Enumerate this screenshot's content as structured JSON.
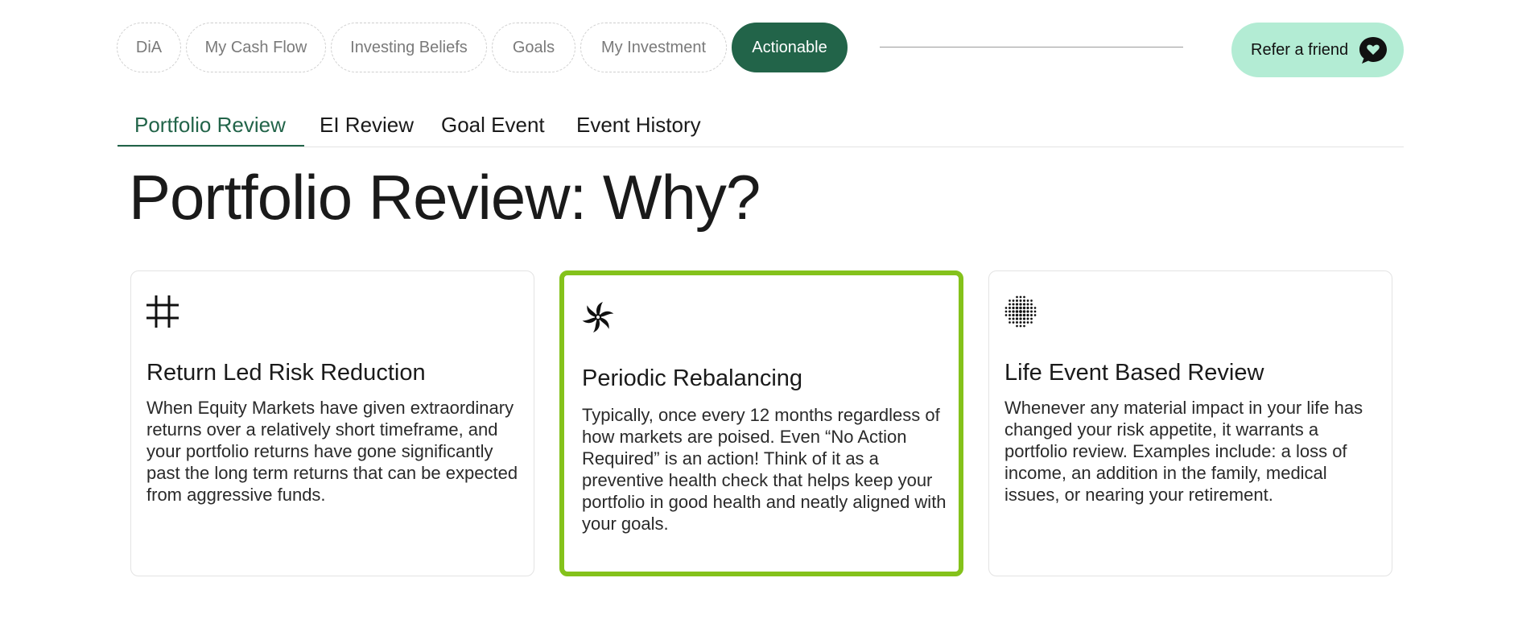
{
  "nav": {
    "pills": [
      "DiA",
      "My Cash Flow",
      "Investing Beliefs",
      "Goals",
      "My Investment",
      "Actionable"
    ],
    "active_pill": "Actionable",
    "refer_label": "Refer a friend"
  },
  "tabs": {
    "items": [
      "Portfolio Review",
      "EI Review",
      "Goal Event",
      "Event History"
    ],
    "active": "Portfolio Review"
  },
  "page_title": "Portfolio Review: Why?",
  "cards": [
    {
      "title": "Return Led Risk Reduction",
      "body": "When Equity Markets have given extraordinary returns over a relatively short timeframe, and your portfolio returns have gone significantly past the long term returns that can be expected from aggressive funds.",
      "icon": "hash-grid-icon"
    },
    {
      "title": "Periodic Rebalancing",
      "body": "Typically, once every 12 months regardless of how markets are poised. Even “No Action Required” is an action! Think of it as a preventive health check that helps keep your portfolio in good health and neatly aligned with your goals.",
      "icon": "pinwheel-icon"
    },
    {
      "title": "Life Event Based Review",
      "body": "Whenever any material impact in your life has changed your risk appetite, it warrants a portfolio review. Examples include: a loss of income, an addition in the family, medical issues, or nearing your retirement.",
      "icon": "dotted-sphere-icon"
    }
  ],
  "colors": {
    "brand_green": "#226449",
    "refer_bg": "#b3ecd4",
    "highlight_border": "#84c21b"
  }
}
